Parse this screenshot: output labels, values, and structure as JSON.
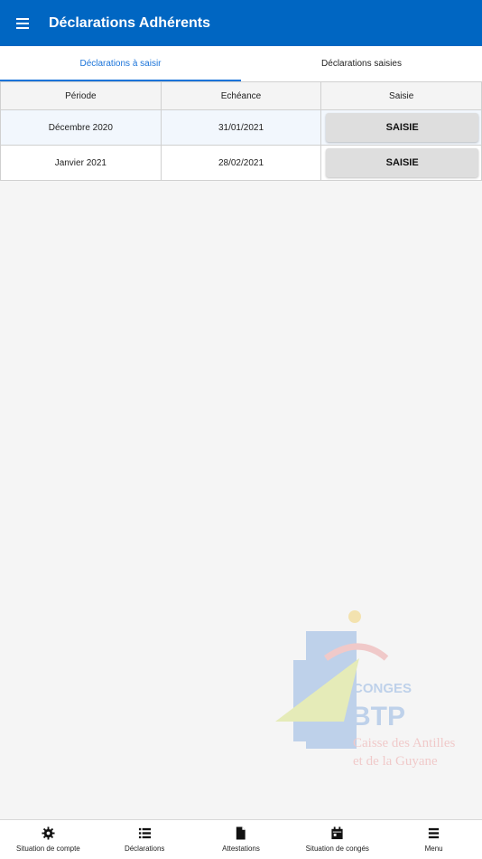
{
  "appbar": {
    "title": "Déclarations Adhérents",
    "menu_icon": "hamburger-icon"
  },
  "tabs": [
    {
      "label": "Déclarations à saisir",
      "active": true
    },
    {
      "label": "Déclarations saisies",
      "active": false
    }
  ],
  "table": {
    "headers": [
      "Période",
      "Echéance",
      "Saisie"
    ],
    "rows": [
      {
        "periode": "Décembre 2020",
        "echeance": "31/01/2021",
        "action": "SAISIE"
      },
      {
        "periode": "Janvier 2021",
        "echeance": "28/02/2021",
        "action": "SAISIE"
      }
    ]
  },
  "logo": {
    "line1": "CONGES",
    "line2": "BTP",
    "line3": "Caisse des Antilles",
    "line4": "et de la Guyane"
  },
  "bottom_nav": [
    {
      "label": "Situation de compte",
      "icon": "gear-icon"
    },
    {
      "label": "Déclarations",
      "icon": "list-icon"
    },
    {
      "label": "Attestations",
      "icon": "document-icon"
    },
    {
      "label": "Situation de congés",
      "icon": "calendar-icon"
    },
    {
      "label": "Menu",
      "icon": "menu-icon"
    }
  ],
  "colors": {
    "primary": "#0066c2",
    "tab_active": "#1a73d9",
    "button_bg": "#dedede"
  }
}
